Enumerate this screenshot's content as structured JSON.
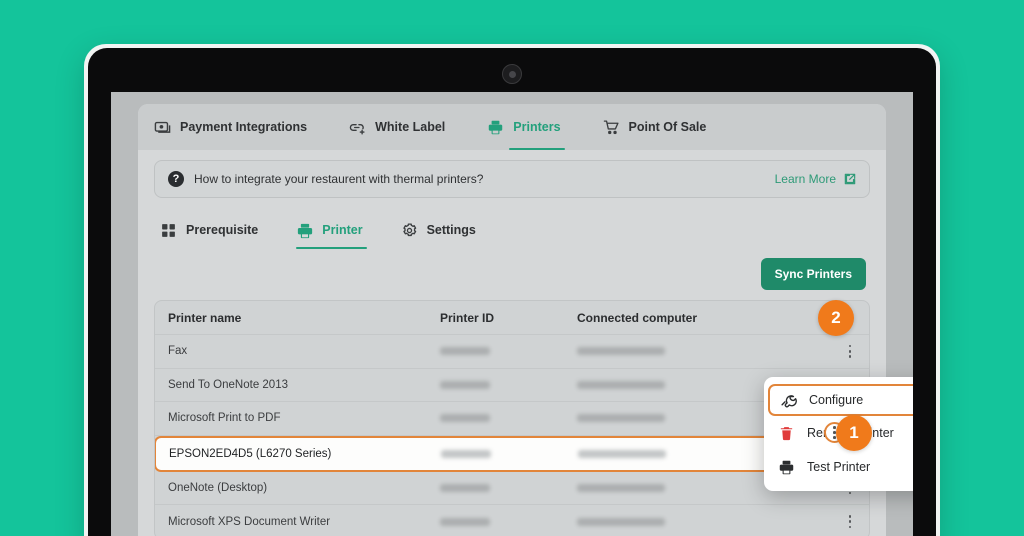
{
  "background_color": "#14C49B",
  "accent_green": "#23a07c",
  "accent_orange": "#e2853a",
  "badge_orange": "#f07a1b",
  "top_tabs": [
    {
      "label": "Payment Integrations",
      "icon": "payment-card-icon",
      "active": false
    },
    {
      "label": "White Label",
      "icon": "link-plus-icon",
      "active": false
    },
    {
      "label": "Printers",
      "icon": "printer-icon",
      "active": true
    },
    {
      "label": "Point Of Sale",
      "icon": "shopping-cart-icon",
      "active": false
    }
  ],
  "banner": {
    "icon": "question-mark-icon",
    "text": "How to integrate your restaurent with thermal printers?",
    "link_label": "Learn More",
    "link_icon": "external-link-icon"
  },
  "sub_tabs": [
    {
      "label": "Prerequisite",
      "icon": "grid-squares-icon",
      "active": false
    },
    {
      "label": "Printer",
      "icon": "printer-icon",
      "active": true
    },
    {
      "label": "Settings",
      "icon": "gear-icon",
      "active": false
    }
  ],
  "toolbar": {
    "sync_label": "Sync Printers"
  },
  "table": {
    "columns": [
      "Printer name",
      "Printer ID",
      "Connected computer"
    ],
    "rows": [
      {
        "name": "Fax",
        "printer_id": "",
        "connected_computer": "",
        "highlighted": false
      },
      {
        "name": "Send To OneNote 2013",
        "printer_id": "",
        "connected_computer": "",
        "highlighted": false
      },
      {
        "name": "Microsoft Print to PDF",
        "printer_id": "",
        "connected_computer": "",
        "highlighted": false
      },
      {
        "name": "EPSON2ED4D5 (L6270 Series)",
        "printer_id": "",
        "connected_computer": "",
        "highlighted": true
      },
      {
        "name": "OneNote (Desktop)",
        "printer_id": "",
        "connected_computer": "",
        "highlighted": false
      },
      {
        "name": "Microsoft XPS Document Writer",
        "printer_id": "",
        "connected_computer": "",
        "highlighted": false
      }
    ]
  },
  "context_menu": {
    "items": [
      {
        "label": "Configure",
        "icon": "wrench-icon",
        "selected": true
      },
      {
        "label": "Remove Printer",
        "icon": "trash-icon",
        "selected": false
      },
      {
        "label": "Test Printer",
        "icon": "printer-icon",
        "selected": false
      }
    ]
  },
  "step_badges": [
    {
      "number": "1"
    },
    {
      "number": "2"
    }
  ]
}
